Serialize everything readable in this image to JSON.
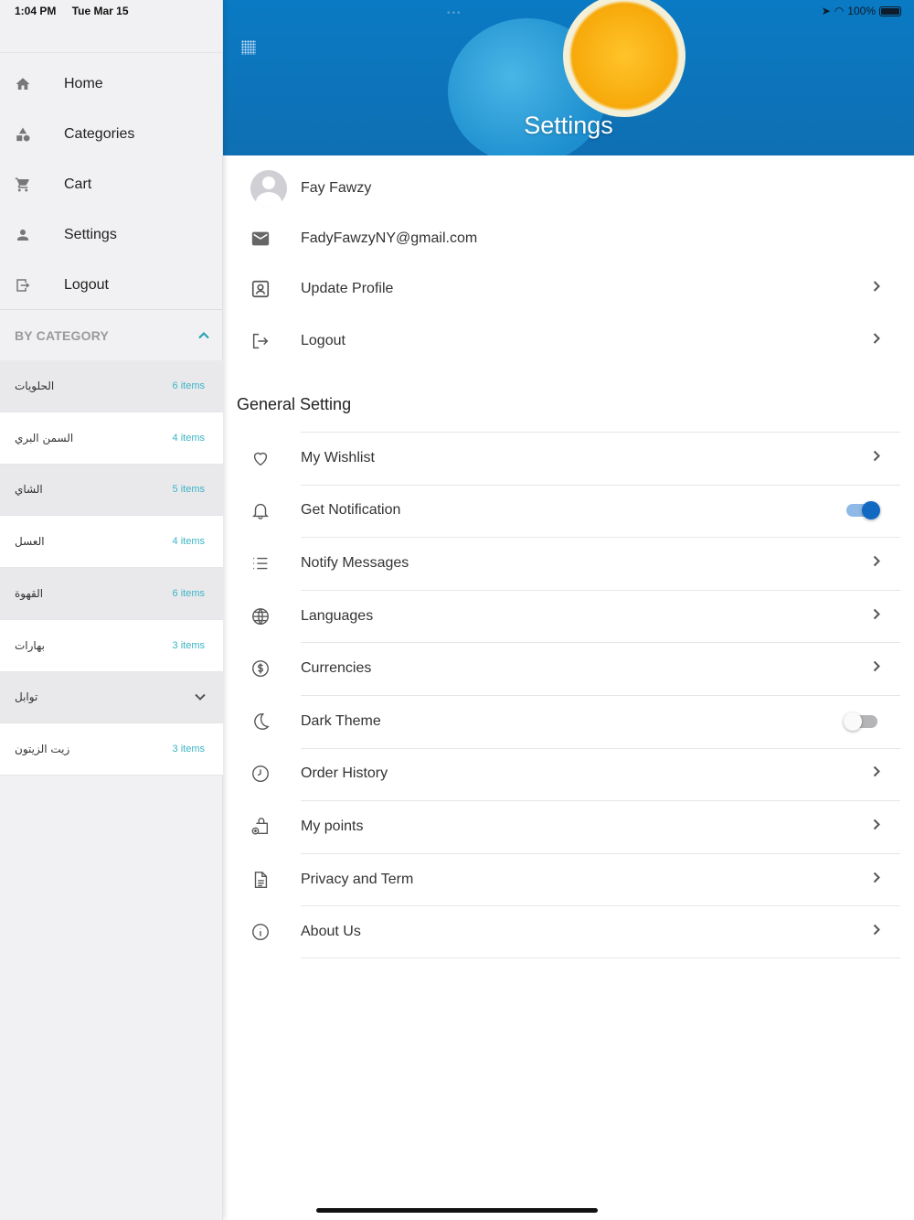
{
  "status": {
    "time": "1:04 PM",
    "date": "Tue Mar 15",
    "battery": "100%"
  },
  "sidebar": {
    "nav": [
      {
        "label": "Home",
        "icon": "home-icon"
      },
      {
        "label": "Categories",
        "icon": "shapes-icon"
      },
      {
        "label": "Cart",
        "icon": "cart-icon"
      },
      {
        "label": "Settings",
        "icon": "person-icon"
      },
      {
        "label": "Logout",
        "icon": "logout-icon"
      }
    ],
    "category_header": "BY CATEGORY",
    "categories": [
      {
        "name": "الحلويات",
        "count": "6 items"
      },
      {
        "name": "السمن البري",
        "count": "4 items"
      },
      {
        "name": "الشاي",
        "count": "5 items"
      },
      {
        "name": "العسل",
        "count": "4 items"
      },
      {
        "name": "القهوة",
        "count": "6 items"
      },
      {
        "name": "بهارات",
        "count": "3 items"
      },
      {
        "name": "توابل",
        "count": ""
      },
      {
        "name": "زيت الزيتون",
        "count": "3 items"
      }
    ]
  },
  "main": {
    "title": "Settings",
    "profile": {
      "name": "Fay Fawzy",
      "email": "FadyFawzyNY@gmail.com",
      "update_label": "Update Profile",
      "logout_label": "Logout"
    },
    "section_title": "General Setting",
    "settings": [
      {
        "label": "My Wishlist",
        "icon": "heart-icon",
        "type": "link"
      },
      {
        "label": "Get Notification",
        "icon": "bell-icon",
        "type": "toggle",
        "on": true
      },
      {
        "label": "Notify Messages",
        "icon": "list-icon",
        "type": "link"
      },
      {
        "label": "Languages",
        "icon": "globe-icon",
        "type": "link"
      },
      {
        "label": "Currencies",
        "icon": "dollar-icon",
        "type": "link"
      },
      {
        "label": "Dark Theme",
        "icon": "moon-icon",
        "type": "toggle",
        "on": false
      },
      {
        "label": "Order History",
        "icon": "clock-icon",
        "type": "link"
      },
      {
        "label": "My points",
        "icon": "bag-plus-icon",
        "type": "link"
      },
      {
        "label": "Privacy and Term",
        "icon": "document-icon",
        "type": "link"
      },
      {
        "label": "About Us",
        "icon": "info-icon",
        "type": "link"
      }
    ]
  },
  "colors": {
    "accent": "#1269c2",
    "teal": "#3bb4c4",
    "hero": "#0a7ac4"
  }
}
